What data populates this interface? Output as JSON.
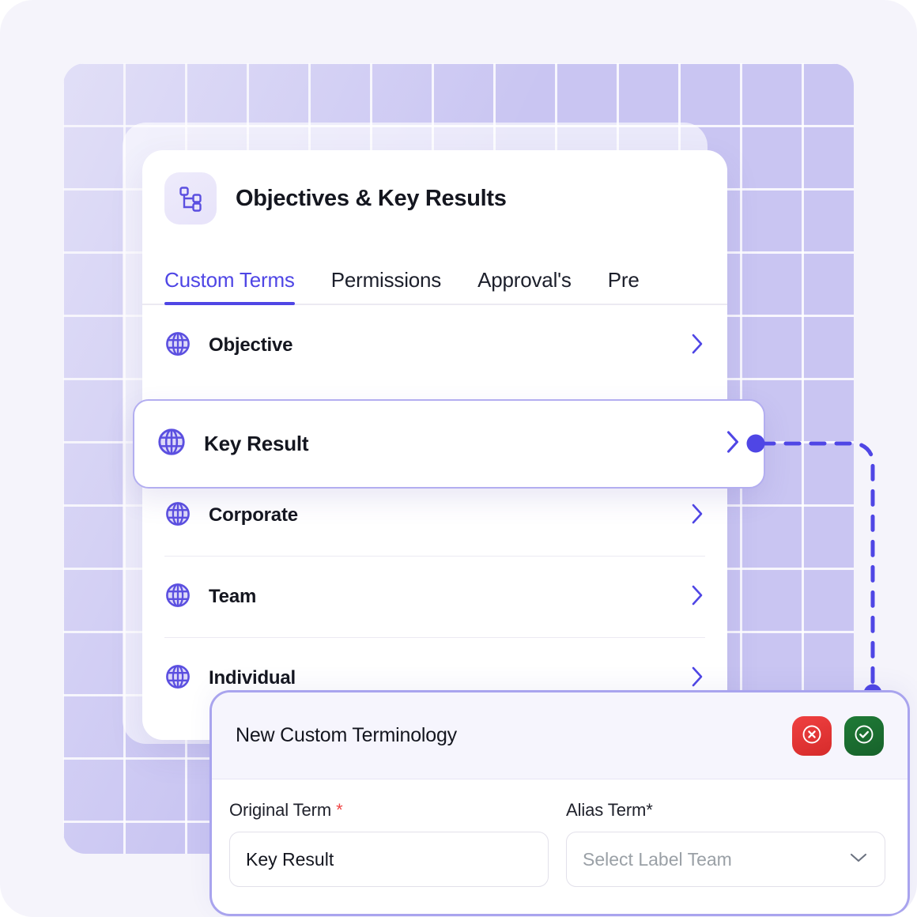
{
  "colors": {
    "accent": "#4f46e5",
    "grid_panel": "#c9c5f2",
    "page_background": "#f5f4fb",
    "highlight_border": "#b3aef0",
    "danger": "#ef4040",
    "success": "#1f7a36",
    "required_asterisk": "#ef4444"
  },
  "app": {
    "title": "Objectives & Key Results",
    "icon": "hierarchy-icon"
  },
  "tabs": [
    {
      "label": "Custom Terms",
      "active": true
    },
    {
      "label": "Permissions",
      "active": false
    },
    {
      "label": "Approval's",
      "active": false
    },
    {
      "label": "Pre",
      "active": false
    }
  ],
  "terms": [
    {
      "label": "Objective",
      "icon": "globe-icon",
      "chevron": "chevron-right-icon"
    },
    {
      "label": "Corporate",
      "icon": "globe-icon",
      "chevron": "chevron-right-icon"
    },
    {
      "label": "Team",
      "icon": "globe-icon",
      "chevron": "chevron-right-icon"
    },
    {
      "label": "Individual",
      "icon": "globe-icon",
      "chevron": "chevron-right-icon"
    }
  ],
  "selected_term": {
    "label": "Key Result",
    "icon": "globe-icon",
    "chevron": "chevron-right-icon"
  },
  "bottom_panel": {
    "title": "New Custom Terminology",
    "cancel_icon": "circle-x-icon",
    "confirm_icon": "circle-check-icon",
    "fields": {
      "original": {
        "label": "Original Term",
        "required_mark": "*",
        "value": "Key Result"
      },
      "alias": {
        "label": "Alias Term*",
        "placeholder": "Select Label Team",
        "caret_icon": "chevron-down-icon"
      }
    }
  }
}
